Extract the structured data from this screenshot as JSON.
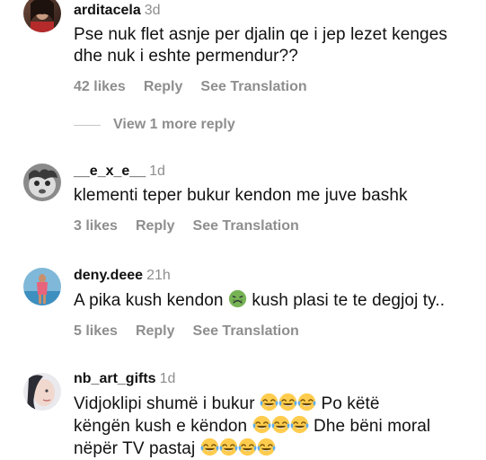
{
  "comments": [
    {
      "username": "arditacela",
      "time": "3d",
      "line1": "Pse nuk flet asnje per djalin qe i jep lezet kenges",
      "line2": "dhe nuk i eshte permendur??",
      "likes": "42 likes",
      "reply": "Reply",
      "translation": "See Translation",
      "view_more": "View 1 more reply"
    },
    {
      "username": "__e_x_e__",
      "time": "1d",
      "line1": "klementi teper bukur kendon me juve bashk",
      "likes": "3 likes",
      "reply": "Reply",
      "translation": "See Translation"
    },
    {
      "username": "deny.deee",
      "time": "21h",
      "part1": "A pika kush kendon",
      "part2": "kush plasi te te degjoj ty..",
      "likes": "5 likes",
      "reply": "Reply",
      "translation": "See Translation",
      "emoji": "nauseated-face-emoji"
    },
    {
      "username": "nb_art_gifts",
      "time": "1d",
      "part1": "Vidjoklipi shumë i bukur",
      "part2": "Po këtë",
      "part3": "këngën kush e këndon",
      "part4": "Dhe bëni moral",
      "part5": "nëpër TV pastaj",
      "emoji": "tears-of-joy-emoji"
    }
  ],
  "colors": {
    "text": "#111111",
    "muted": "#8e8e8e",
    "background": "#ffffff"
  }
}
